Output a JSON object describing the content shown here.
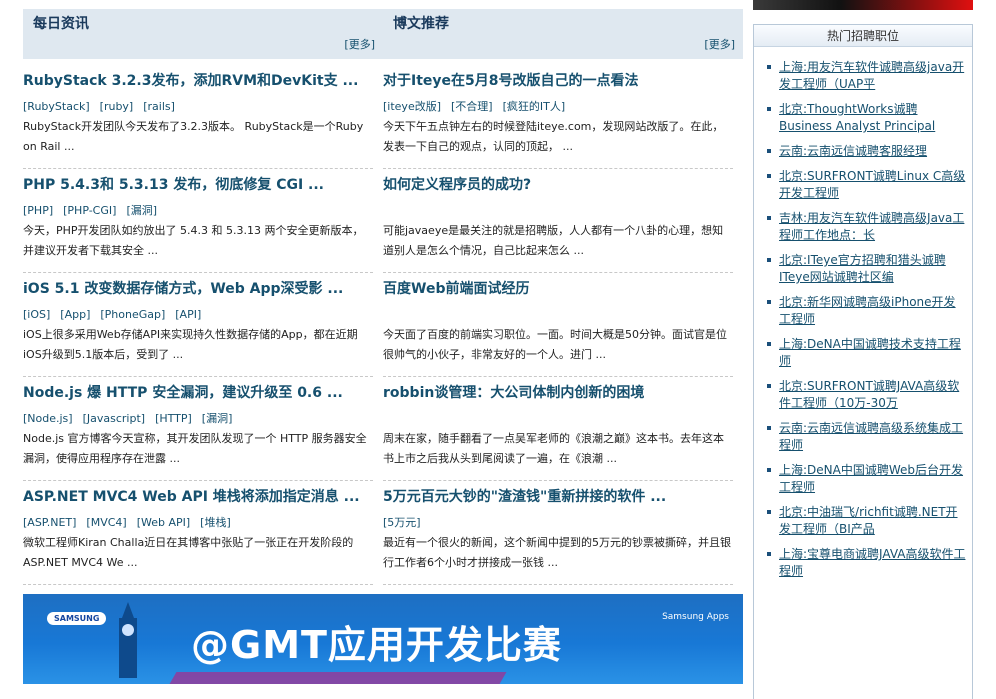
{
  "left_column": {
    "title": "每日资讯",
    "more": "[更多]",
    "articles": [
      {
        "title": "RubyStack 3.2.3发布，添加RVM和DevKit支 ...",
        "tags": [
          "[RubyStack]",
          "[ruby]",
          "[rails]"
        ],
        "summary": "RubyStack开发团队今天发布了3.2.3版本。 RubyStack是一个Ruby on Rail ..."
      },
      {
        "title": "PHP 5.4.3和 5.3.13 发布，彻底修复 CGI ...",
        "tags": [
          "[PHP]",
          "[PHP-CGI]",
          "[漏洞]"
        ],
        "summary": "今天，PHP开发团队如约放出了 5.4.3 和 5.3.13 两个安全更新版本，并建议开发者下载其安全 ..."
      },
      {
        "title": "iOS 5.1 改变数据存储方式，Web App深受影 ...",
        "tags": [
          "[iOS]",
          "[App]",
          "[PhoneGap]",
          "[API]"
        ],
        "summary": "iOS上很多采用Web存储API来实现持久性数据存储的App，都在近期iOS升级到5.1版本后，受到了 ..."
      },
      {
        "title": "Node.js 爆 HTTP 安全漏洞，建议升级至 0.6 ...",
        "tags": [
          "[Node.js]",
          "[Javascript]",
          "[HTTP]",
          "[漏洞]"
        ],
        "summary": "Node.js 官方博客今天宣称，其开发团队发现了一个 HTTP 服务器安全漏洞，使得应用程序存在泄露 ..."
      },
      {
        "title": "ASP.NET MVC4 Web API 堆栈将添加指定消息 ...",
        "tags": [
          "[ASP.NET]",
          "[MVC4]",
          "[Web API]",
          "[堆栈]"
        ],
        "summary": "微软工程师Kiran Challa近日在其博客中张贴了一张正在开发阶段的ASP.NET MVC4 We ..."
      }
    ]
  },
  "right_column": {
    "title": "博文推荐",
    "more": "[更多]",
    "articles": [
      {
        "title": "对于Iteye在5月8号改版自己的一点看法",
        "tags": [
          "[iteye改版]",
          "[不合理]",
          "[疯狂的IT人]"
        ],
        "summary": "今天下午五点钟左右的时候登陆iteye.com，发现网站改版了。在此，发表一下自己的观点，认同的顶起， ..."
      },
      {
        "title": "如何定义程序员的成功?",
        "tags": [],
        "summary": "可能javaeye是最关注的就是招聘版，人人都有一个八卦的心理，想知道别人是怎么个情况，自己比起来怎么 ..."
      },
      {
        "title": "百度Web前端面试经历",
        "tags": [],
        "summary": "今天面了百度的前端实习职位。一面。时间大概是50分钟。面试官是位很帅气的小伙子，非常友好的一个人。进门 ..."
      },
      {
        "title": "robbin谈管理：大公司体制内创新的困境",
        "tags": [],
        "summary": "周末在家，随手翻看了一点吴军老师的《浪潮之巅》这本书。去年这本书上市之后我从头到尾阅读了一遍，在《浪潮 ..."
      },
      {
        "title": "5万元百元大钞的\"渣渣钱\"重新拼接的软件 ...",
        "tags": [
          "[5万元]"
        ],
        "summary": "最近有一个很火的新闻，这个新闻中提到的5万元的钞票被撕碎，并且银行工作者6个小时才拼接成一张钱 ..."
      }
    ]
  },
  "banner": {
    "logo": "SAMSUNG",
    "text": "@GMT应用开发比赛",
    "apps_label": "Samsung Apps"
  },
  "sidebar": {
    "title": "热门招聘职位",
    "jobs": [
      "上海:用友汽车软件诚聘高级java开发工程师（UAP平",
      "北京:ThoughtWorks诚聘Business Analyst Principal",
      "云南:云南远信诚聘客服经理",
      "北京:SURFRONT诚聘Linux C高级开发工程师",
      "吉林:用友汽车软件诚聘高级Java工程师工作地点：长",
      "北京:ITeye官方招聘和猎头诚聘ITeye网站诚聘社区编",
      "北京:新华网诚聘高级iPhone开发工程师",
      "上海:DeNA中国诚聘技术支持工程师",
      "北京:SURFRONT诚聘JAVA高级软件工程师（10万-30万",
      "云南:云南远信诚聘高级系统集成工程师",
      "上海:DeNA中国诚聘Web后台开发工程师",
      "北京:中油瑞飞/richfit诚聘.NET开发工程师（BI产品",
      "上海:宝尊电商诚聘JAVA高级软件工程师"
    ]
  }
}
